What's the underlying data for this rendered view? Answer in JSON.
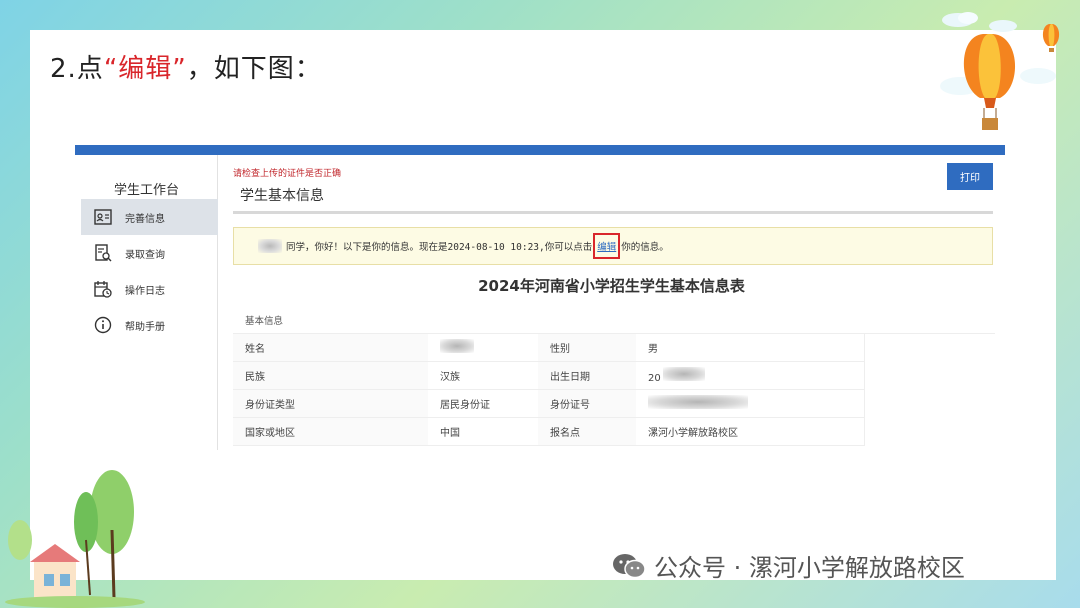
{
  "slide": {
    "title_prefix": "2.点",
    "title_highlight": "“编辑”",
    "title_suffix": "，如下图：",
    "watermark": "公众号 · 漯河小学解放路校区"
  },
  "sidebar": {
    "title": "学生工作台",
    "items": [
      {
        "label": "完善信息",
        "icon": "profile-card-icon",
        "active": true
      },
      {
        "label": "录取查询",
        "icon": "search-document-icon",
        "active": false
      },
      {
        "label": "操作日志",
        "icon": "calendar-clock-icon",
        "active": false
      },
      {
        "label": "帮助手册",
        "icon": "info-icon",
        "active": false
      }
    ]
  },
  "main": {
    "warning": "请检查上传的证件是否正确",
    "section_title": "学生基本信息",
    "print_label": "打印",
    "notice_before": "同学，你好！以下是你的信息。现在是2024-08-10 10:23,你可以点击",
    "notice_link": "编辑",
    "notice_after": "你的信息。",
    "table_title": "2024年河南省小学招生学生基本信息表",
    "table_header": "基本信息",
    "rows": [
      {
        "k1": "姓名",
        "v1": "",
        "k2": "性别",
        "v2": "男"
      },
      {
        "k1": "民族",
        "v1": "汉族",
        "k2": "出生日期",
        "v2": "20"
      },
      {
        "k1": "身份证类型",
        "v1": "居民身份证",
        "k2": "身份证号",
        "v2": ""
      },
      {
        "k1": "国家或地区",
        "v1": "中国",
        "k2": "报名点",
        "v2": "漯河小学解放路校区"
      }
    ]
  },
  "colors": {
    "accent_blue": "#2f6cc0",
    "highlight_red": "#d9262b"
  }
}
